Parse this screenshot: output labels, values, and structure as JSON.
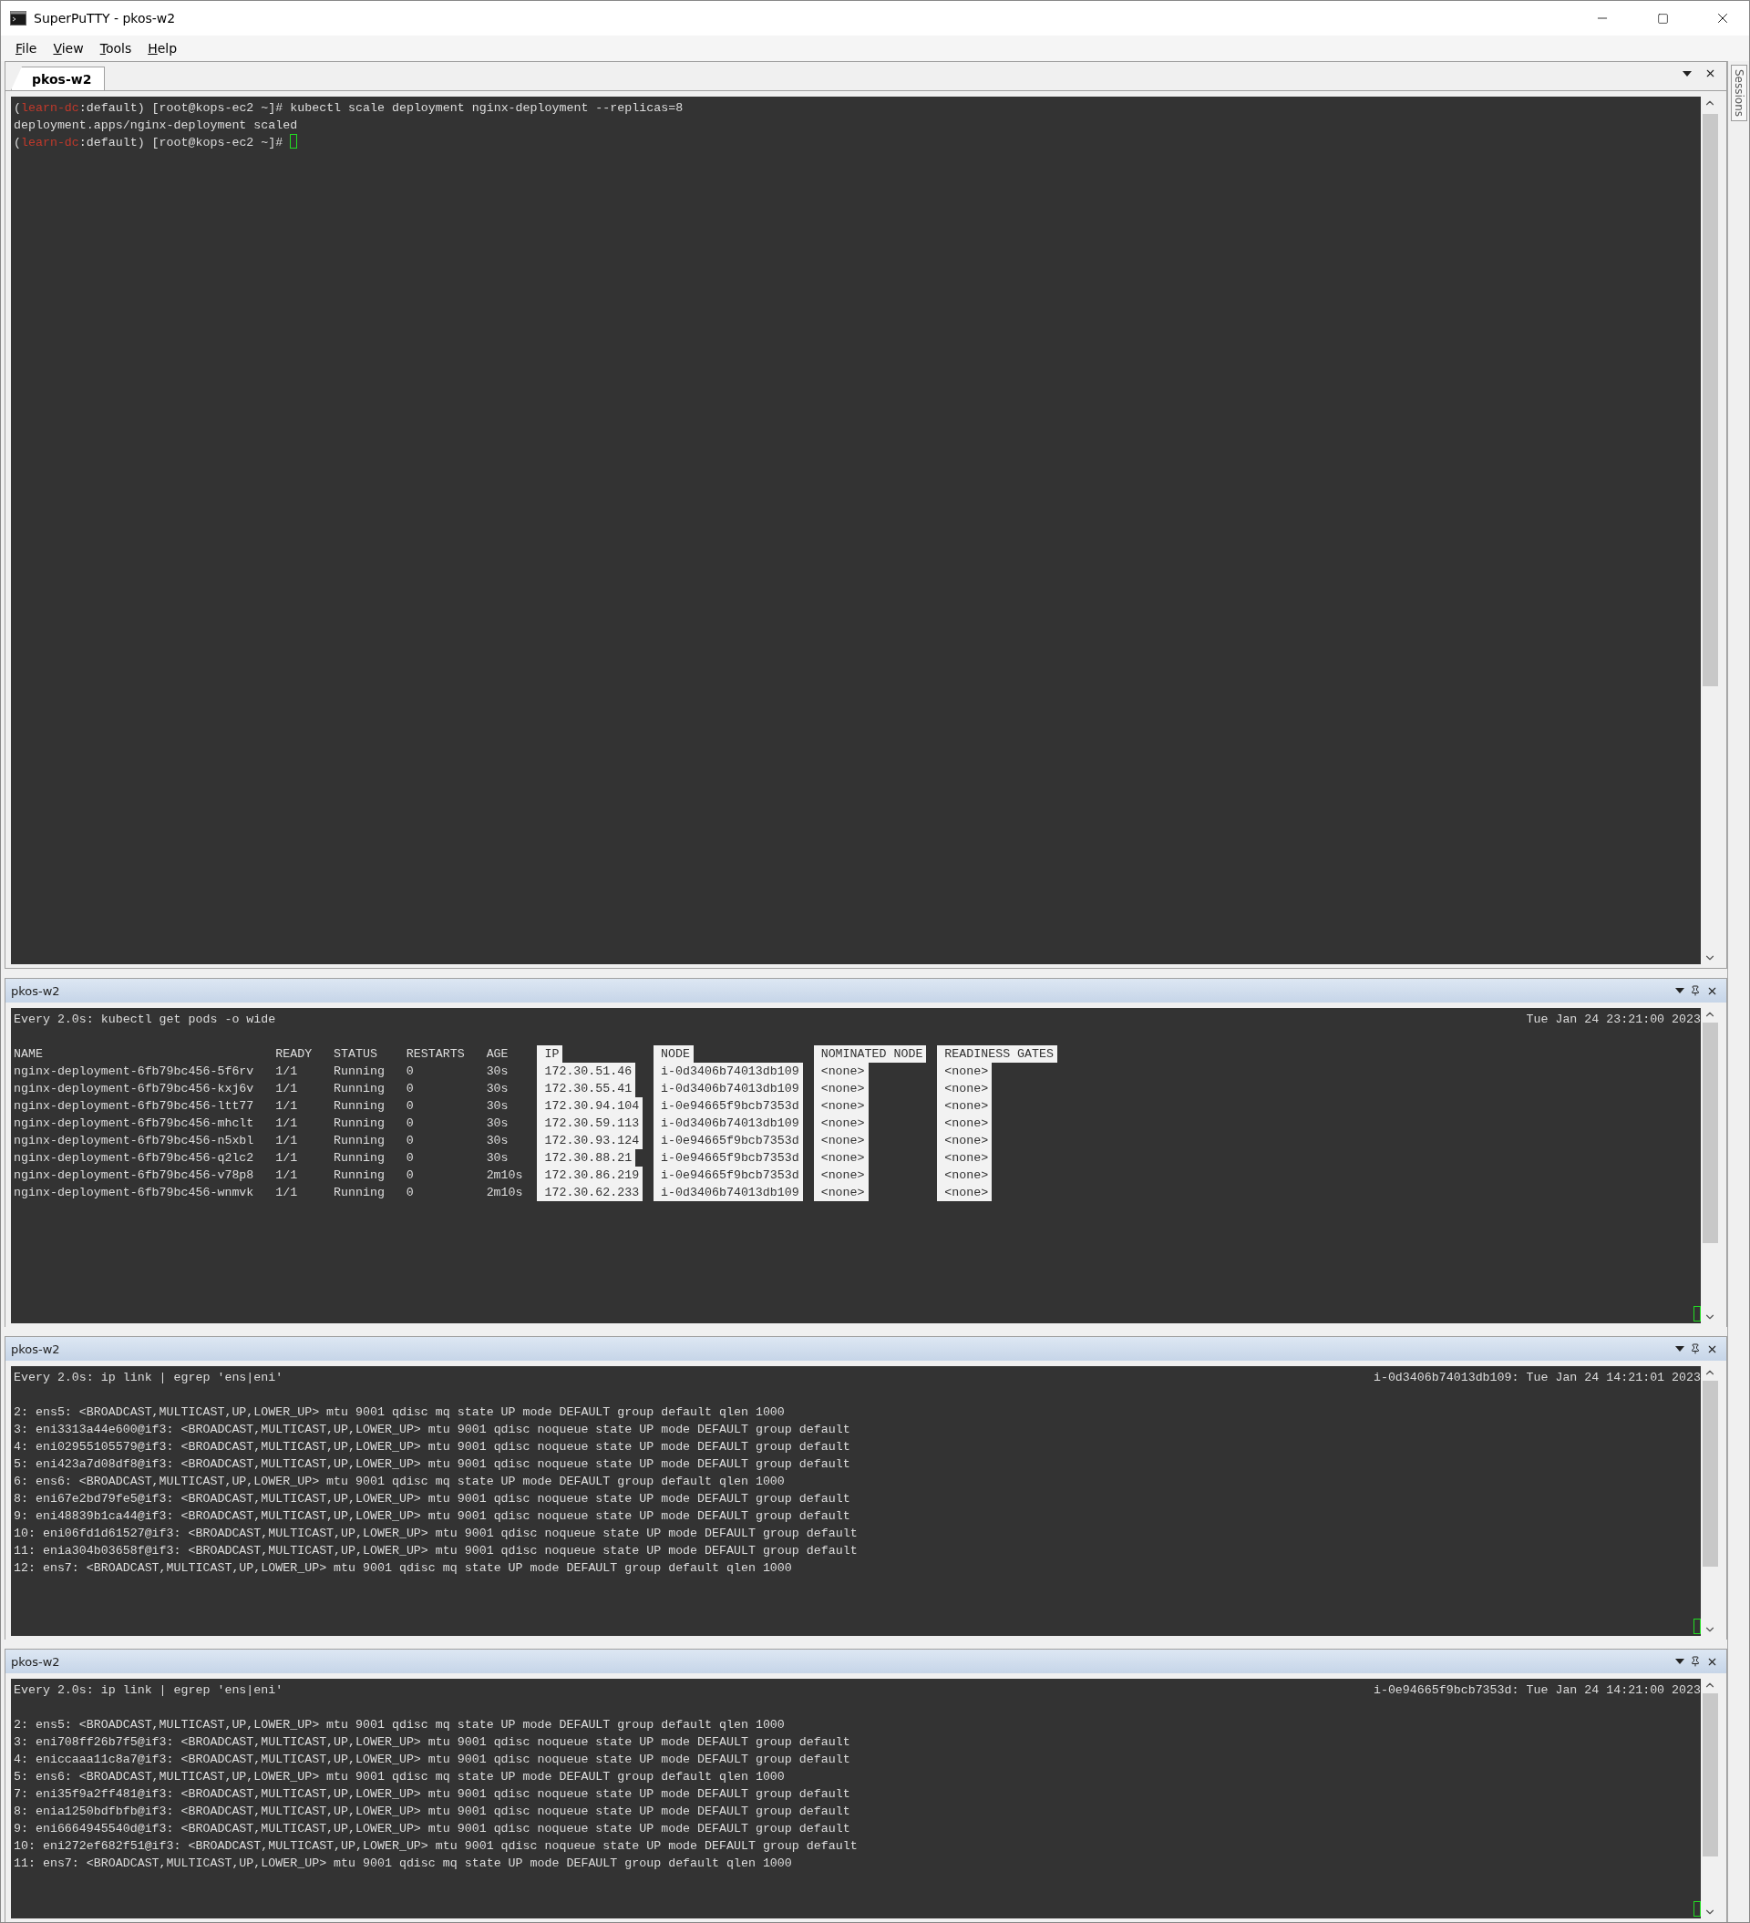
{
  "window": {
    "title": "SuperPuTTY - pkos-w2"
  },
  "menu": [
    "File",
    "View",
    "Tools",
    "Help"
  ],
  "tabs": [
    {
      "label": "pkos-w2",
      "selected": true
    }
  ],
  "sessions_tab": {
    "label": "Sessions"
  },
  "main_terminal": {
    "lines": [
      {
        "cursor": false,
        "segments": [
          {
            "text": "("
          },
          {
            "text": "learn-dc",
            "color": "#c0392b"
          },
          {
            "text": ":default) [root@kops-ec2 ~]# kubectl scale deployment nginx-deployment --replicas=8"
          }
        ]
      },
      {
        "cursor": false,
        "segments": [
          {
            "text": "deployment.apps/nginx-deployment scaled"
          }
        ]
      },
      {
        "cursor": true,
        "segments": [
          {
            "text": "("
          },
          {
            "text": "learn-dc",
            "color": "#c0392b"
          },
          {
            "text": ":default) [root@kops-ec2 ~]# "
          }
        ]
      }
    ]
  },
  "panes": [
    {
      "title": "pkos-w2",
      "kind": "table",
      "command": "Every 2.0s: kubectl get pods -o wide",
      "timestamp": "Tue Jan 24 23:21:00 2023",
      "columns": [
        {
          "label": "NAME",
          "highlighted": false
        },
        {
          "label": "READY",
          "highlighted": false
        },
        {
          "label": "STATUS",
          "highlighted": false
        },
        {
          "label": "RESTARTS",
          "highlighted": false
        },
        {
          "label": "AGE",
          "highlighted": false
        },
        {
          "label": "IP",
          "highlighted": true
        },
        {
          "label": "NODE",
          "highlighted": true
        },
        {
          "label": "NOMINATED NODE",
          "highlighted": true
        },
        {
          "label": "READINESS GATES",
          "highlighted": true
        }
      ],
      "rows": [
        [
          "nginx-deployment-6fb79bc456-5f6rv",
          "1/1",
          "Running",
          "0",
          "30s",
          "172.30.51.46",
          "i-0d3406b74013db109",
          "<none>",
          "<none>"
        ],
        [
          "nginx-deployment-6fb79bc456-kxj6v",
          "1/1",
          "Running",
          "0",
          "30s",
          "172.30.55.41",
          "i-0d3406b74013db109",
          "<none>",
          "<none>"
        ],
        [
          "nginx-deployment-6fb79bc456-ltt77",
          "1/1",
          "Running",
          "0",
          "30s",
          "172.30.94.104",
          "i-0e94665f9bcb7353d",
          "<none>",
          "<none>"
        ],
        [
          "nginx-deployment-6fb79bc456-mhclt",
          "1/1",
          "Running",
          "0",
          "30s",
          "172.30.59.113",
          "i-0d3406b74013db109",
          "<none>",
          "<none>"
        ],
        [
          "nginx-deployment-6fb79bc456-n5xbl",
          "1/1",
          "Running",
          "0",
          "30s",
          "172.30.93.124",
          "i-0e94665f9bcb7353d",
          "<none>",
          "<none>"
        ],
        [
          "nginx-deployment-6fb79bc456-q2lc2",
          "1/1",
          "Running",
          "0",
          "30s",
          "172.30.88.21",
          "i-0e94665f9bcb7353d",
          "<none>",
          "<none>"
        ],
        [
          "nginx-deployment-6fb79bc456-v78p8",
          "1/1",
          "Running",
          "0",
          "2m10s",
          "172.30.86.219",
          "i-0e94665f9bcb7353d",
          "<none>",
          "<none>"
        ],
        [
          "nginx-deployment-6fb79bc456-wnmvk",
          "1/1",
          "Running",
          "0",
          "2m10s",
          "172.30.62.233",
          "i-0d3406b74013db109",
          "<none>",
          "<none>"
        ]
      ]
    },
    {
      "title": "pkos-w2",
      "kind": "lines",
      "command": "Every 2.0s: ip link | egrep 'ens|eni'",
      "timestamp": "i-0d3406b74013db109: Tue Jan 24 14:21:01 2023",
      "lines": [
        "2: ens5: <BROADCAST,MULTICAST,UP,LOWER_UP> mtu 9001 qdisc mq state UP mode DEFAULT group default qlen 1000",
        "3: eni3313a44e600@if3: <BROADCAST,MULTICAST,UP,LOWER_UP> mtu 9001 qdisc noqueue state UP mode DEFAULT group default",
        "4: eni02955105579@if3: <BROADCAST,MULTICAST,UP,LOWER_UP> mtu 9001 qdisc noqueue state UP mode DEFAULT group default",
        "5: eni423a7d08df8@if3: <BROADCAST,MULTICAST,UP,LOWER_UP> mtu 9001 qdisc noqueue state UP mode DEFAULT group default",
        "6: ens6: <BROADCAST,MULTICAST,UP,LOWER_UP> mtu 9001 qdisc mq state UP mode DEFAULT group default qlen 1000",
        "8: eni67e2bd79fe5@if3: <BROADCAST,MULTICAST,UP,LOWER_UP> mtu 9001 qdisc noqueue state UP mode DEFAULT group default",
        "9: eni48839b1ca44@if3: <BROADCAST,MULTICAST,UP,LOWER_UP> mtu 9001 qdisc noqueue state UP mode DEFAULT group default",
        "10: eni06fd1d61527@if3: <BROADCAST,MULTICAST,UP,LOWER_UP> mtu 9001 qdisc noqueue state UP mode DEFAULT group default",
        "11: enia304b03658f@if3: <BROADCAST,MULTICAST,UP,LOWER_UP> mtu 9001 qdisc noqueue state UP mode DEFAULT group default",
        "12: ens7: <BROADCAST,MULTICAST,UP,LOWER_UP> mtu 9001 qdisc mq state UP mode DEFAULT group default qlen 1000"
      ]
    },
    {
      "title": "pkos-w2",
      "kind": "lines",
      "command": "Every 2.0s: ip link | egrep 'ens|eni'",
      "timestamp": "i-0e94665f9bcb7353d: Tue Jan 24 14:21:00 2023",
      "lines": [
        "2: ens5: <BROADCAST,MULTICAST,UP,LOWER_UP> mtu 9001 qdisc mq state UP mode DEFAULT group default qlen 1000",
        "3: eni708ff26b7f5@if3: <BROADCAST,MULTICAST,UP,LOWER_UP> mtu 9001 qdisc noqueue state UP mode DEFAULT group default",
        "4: eniccaaa11c8a7@if3: <BROADCAST,MULTICAST,UP,LOWER_UP> mtu 9001 qdisc noqueue state UP mode DEFAULT group default",
        "5: ens6: <BROADCAST,MULTICAST,UP,LOWER_UP> mtu 9001 qdisc mq state UP mode DEFAULT group default qlen 1000",
        "7: eni35f9a2ff481@if3: <BROADCAST,MULTICAST,UP,LOWER_UP> mtu 9001 qdisc noqueue state UP mode DEFAULT group default",
        "8: enia1250bdfbfb@if3: <BROADCAST,MULTICAST,UP,LOWER_UP> mtu 9001 qdisc noqueue state UP mode DEFAULT group default",
        "9: eni6664945540d@if3: <BROADCAST,MULTICAST,UP,LOWER_UP> mtu 9001 qdisc noqueue state UP mode DEFAULT group default",
        "10: eni272ef682f51@if3: <BROADCAST,MULTICAST,UP,LOWER_UP> mtu 9001 qdisc noqueue state UP mode DEFAULT group default",
        "11: ens7: <BROADCAST,MULTICAST,UP,LOWER_UP> mtu 9001 qdisc mq state UP mode DEFAULT group default qlen 1000"
      ]
    }
  ]
}
